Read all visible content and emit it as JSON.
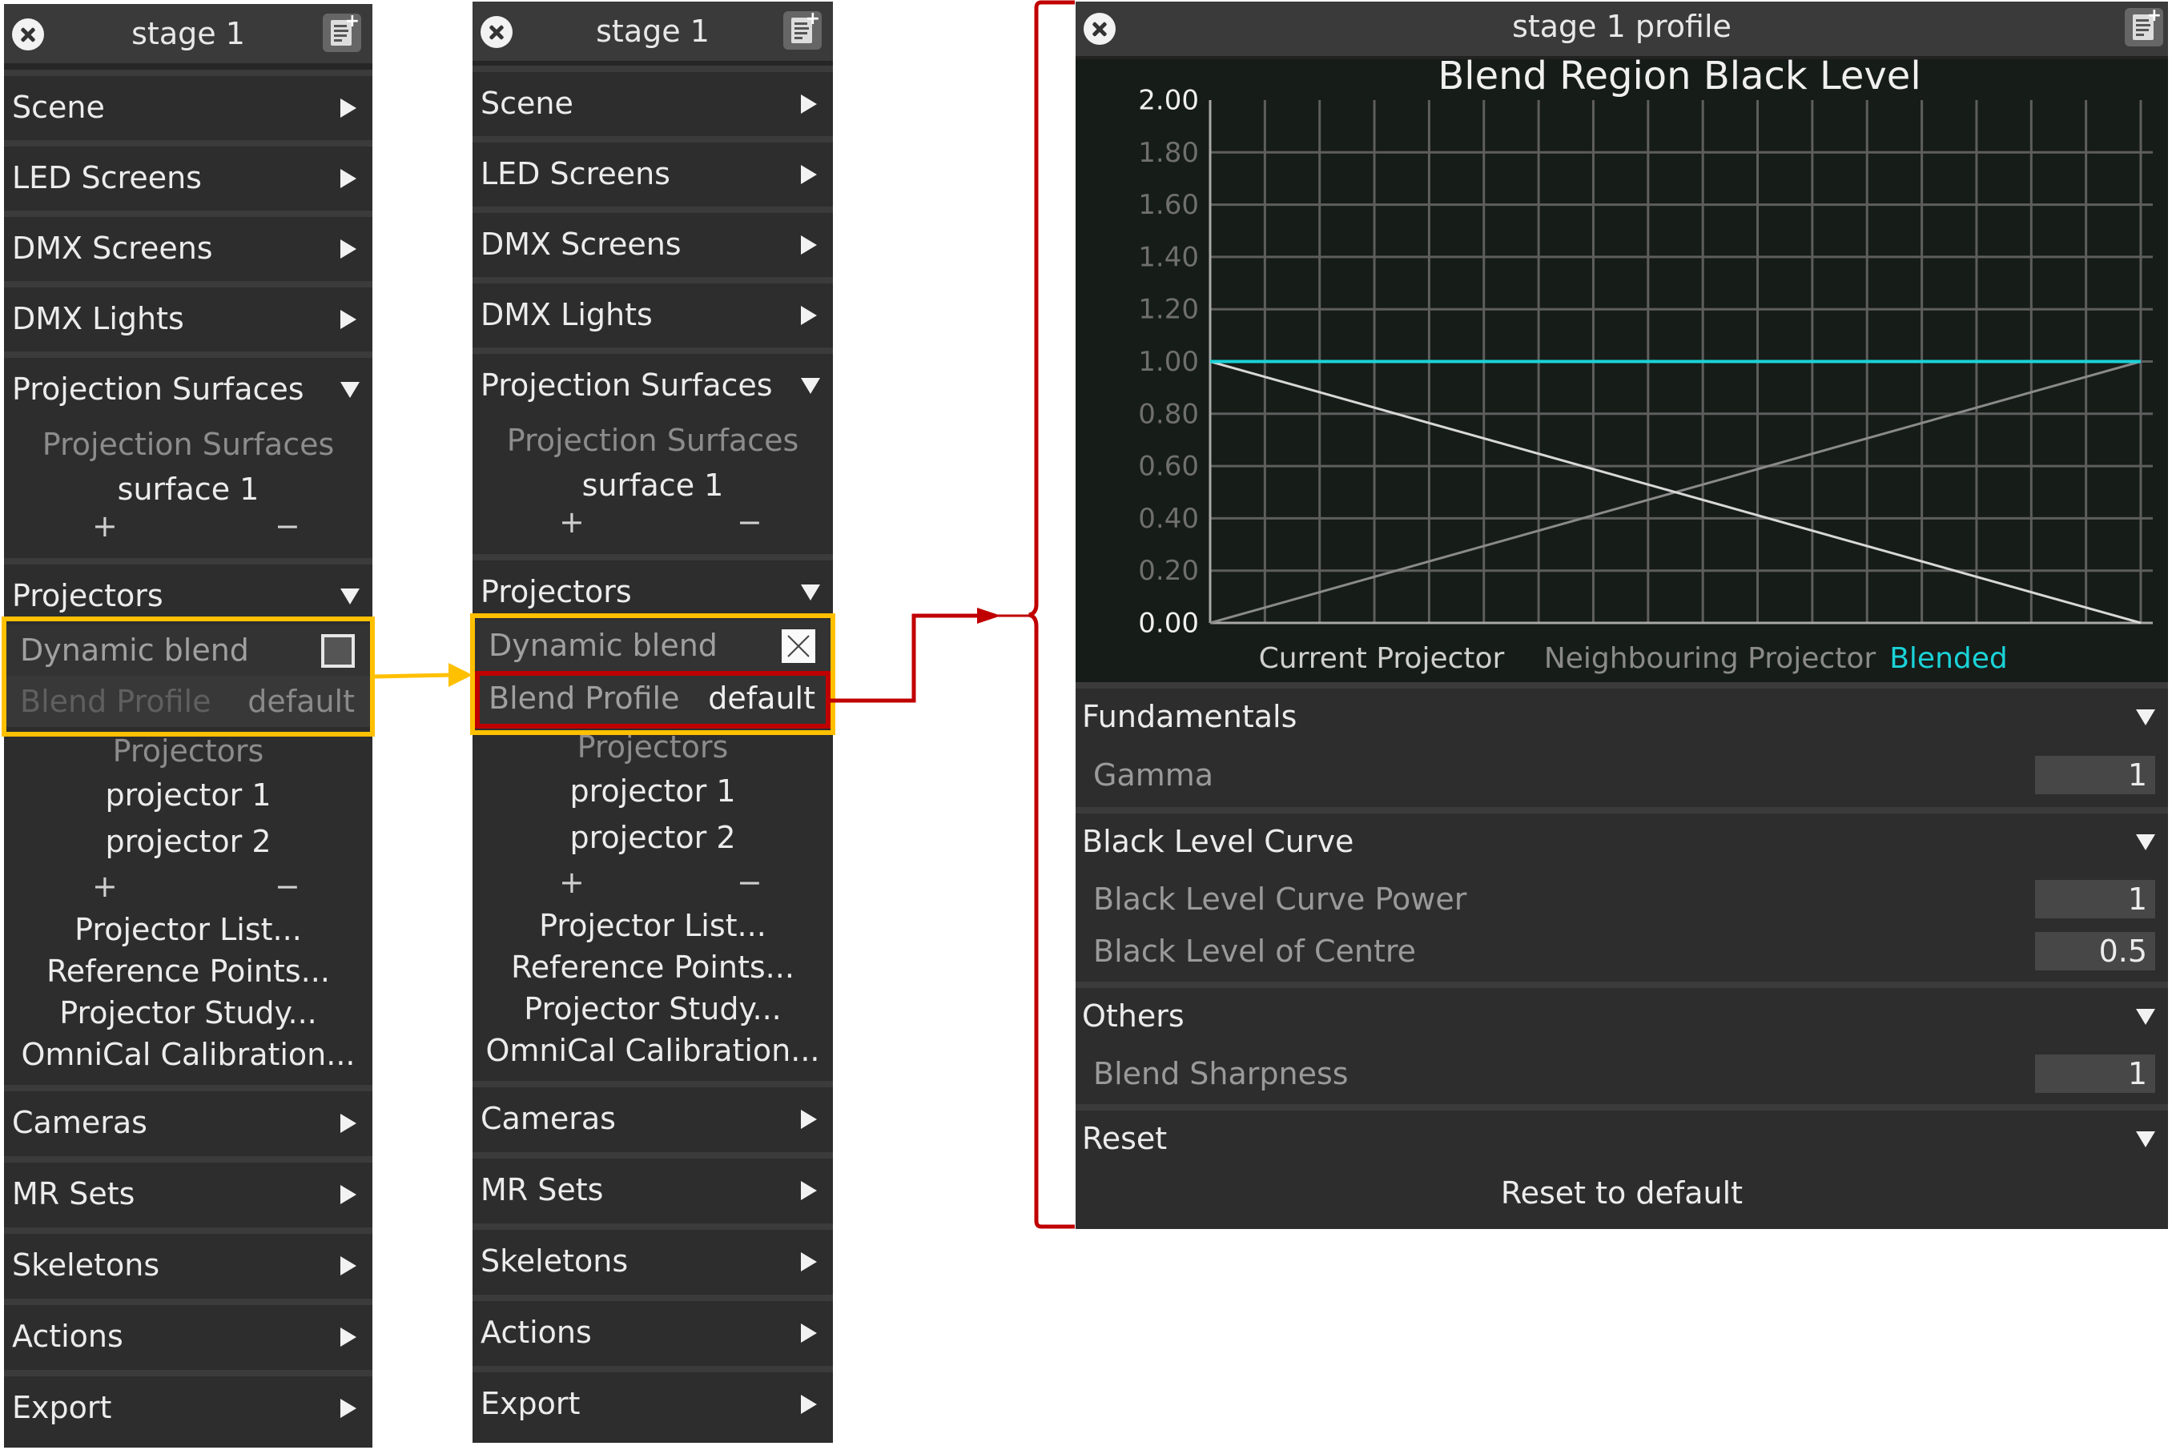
{
  "colors": {
    "panel_bg": "#2d2d2d",
    "highlight_yellow": "#ffc000",
    "highlight_red": "#c00000",
    "blended_line": "#1ad3d8",
    "current_line": "#d8d8d8",
    "neighbour_line": "#8a8a8a"
  },
  "panel_left": {
    "title": "stage 1",
    "close_icon": "close-circle-icon",
    "note_icon": "add-note-icon",
    "menu": [
      {
        "label": "Scene",
        "state": "collapsed"
      },
      {
        "label": "LED Screens",
        "state": "collapsed"
      },
      {
        "label": "DMX Screens",
        "state": "collapsed"
      },
      {
        "label": "DMX Lights",
        "state": "collapsed"
      },
      {
        "label": "Projection Surfaces",
        "state": "expanded"
      },
      {
        "label": "Projectors",
        "state": "expanded"
      },
      {
        "label": "Cameras",
        "state": "collapsed"
      },
      {
        "label": "MR Sets",
        "state": "collapsed"
      },
      {
        "label": "Skeletons",
        "state": "collapsed"
      },
      {
        "label": "Actions",
        "state": "collapsed"
      },
      {
        "label": "Export",
        "state": "collapsed"
      }
    ],
    "surfaces": {
      "heading": "Projection Surfaces",
      "items": [
        "surface 1"
      ],
      "add": "+",
      "remove": "−"
    },
    "dynamic_blend": {
      "label": "Dynamic blend",
      "checked": false
    },
    "blend_profile": {
      "label": "Blend Profile",
      "value": "default",
      "enabled": false
    },
    "projectors": {
      "heading": "Projectors",
      "items": [
        "projector 1",
        "projector 2"
      ],
      "add": "+",
      "remove": "−"
    },
    "actions": [
      "Projector List...",
      "Reference Points...",
      "Projector Study...",
      "OmniCal Calibration..."
    ]
  },
  "panel_mid": {
    "title": "stage 1",
    "menu": [
      {
        "label": "Scene",
        "state": "collapsed"
      },
      {
        "label": "LED Screens",
        "state": "collapsed"
      },
      {
        "label": "DMX Screens",
        "state": "collapsed"
      },
      {
        "label": "DMX Lights",
        "state": "collapsed"
      },
      {
        "label": "Projection Surfaces",
        "state": "expanded"
      },
      {
        "label": "Projectors",
        "state": "expanded"
      },
      {
        "label": "Cameras",
        "state": "collapsed"
      },
      {
        "label": "MR Sets",
        "state": "collapsed"
      },
      {
        "label": "Skeletons",
        "state": "collapsed"
      },
      {
        "label": "Actions",
        "state": "collapsed"
      },
      {
        "label": "Export",
        "state": "collapsed"
      }
    ],
    "surfaces": {
      "heading": "Projection Surfaces",
      "items": [
        "surface 1"
      ],
      "add": "+",
      "remove": "−"
    },
    "dynamic_blend": {
      "label": "Dynamic blend",
      "checked": true
    },
    "blend_profile": {
      "label": "Blend Profile",
      "value": "default",
      "enabled": true
    },
    "projectors": {
      "heading": "Projectors",
      "items": [
        "projector 1",
        "projector 2"
      ],
      "add": "+",
      "remove": "−"
    },
    "actions": [
      "Projector List...",
      "Reference Points...",
      "Projector Study...",
      "OmniCal Calibration..."
    ]
  },
  "panel_profile": {
    "title": "stage 1 profile",
    "sections": [
      {
        "label": "Fundamentals",
        "props": [
          {
            "label": "Gamma",
            "value": "1"
          }
        ]
      },
      {
        "label": "Black Level Curve",
        "props": [
          {
            "label": "Black Level Curve Power",
            "value": "1"
          },
          {
            "label": "Black Level of Centre",
            "value": "0.5"
          }
        ]
      },
      {
        "label": "Others",
        "props": [
          {
            "label": "Blend Sharpness",
            "value": "1"
          }
        ]
      },
      {
        "label": "Reset",
        "button": "Reset to default"
      }
    ]
  },
  "chart_data": {
    "type": "line",
    "title": "Blend Region Black Level",
    "xlabel": "",
    "ylabel": "",
    "x": [
      0,
      1
    ],
    "xlim": [
      0,
      1
    ],
    "ylim": [
      0,
      2
    ],
    "yticks": [
      "0.00",
      "0.20",
      "0.40",
      "0.60",
      "0.80",
      "1.00",
      "1.20",
      "1.40",
      "1.60",
      "1.80",
      "2.00"
    ],
    "x_gridlines": 17,
    "grid": true,
    "legend_position": "bottom",
    "series": [
      {
        "name": "Current Projector",
        "color": "#d8d8d8",
        "values": [
          1.0,
          0.0
        ]
      },
      {
        "name": "Neighbouring Projector",
        "color": "#8a8a8a",
        "values": [
          0.0,
          1.0
        ]
      },
      {
        "name": "Blended",
        "color": "#1ad3d8",
        "values": [
          1.0,
          1.0
        ]
      }
    ]
  }
}
